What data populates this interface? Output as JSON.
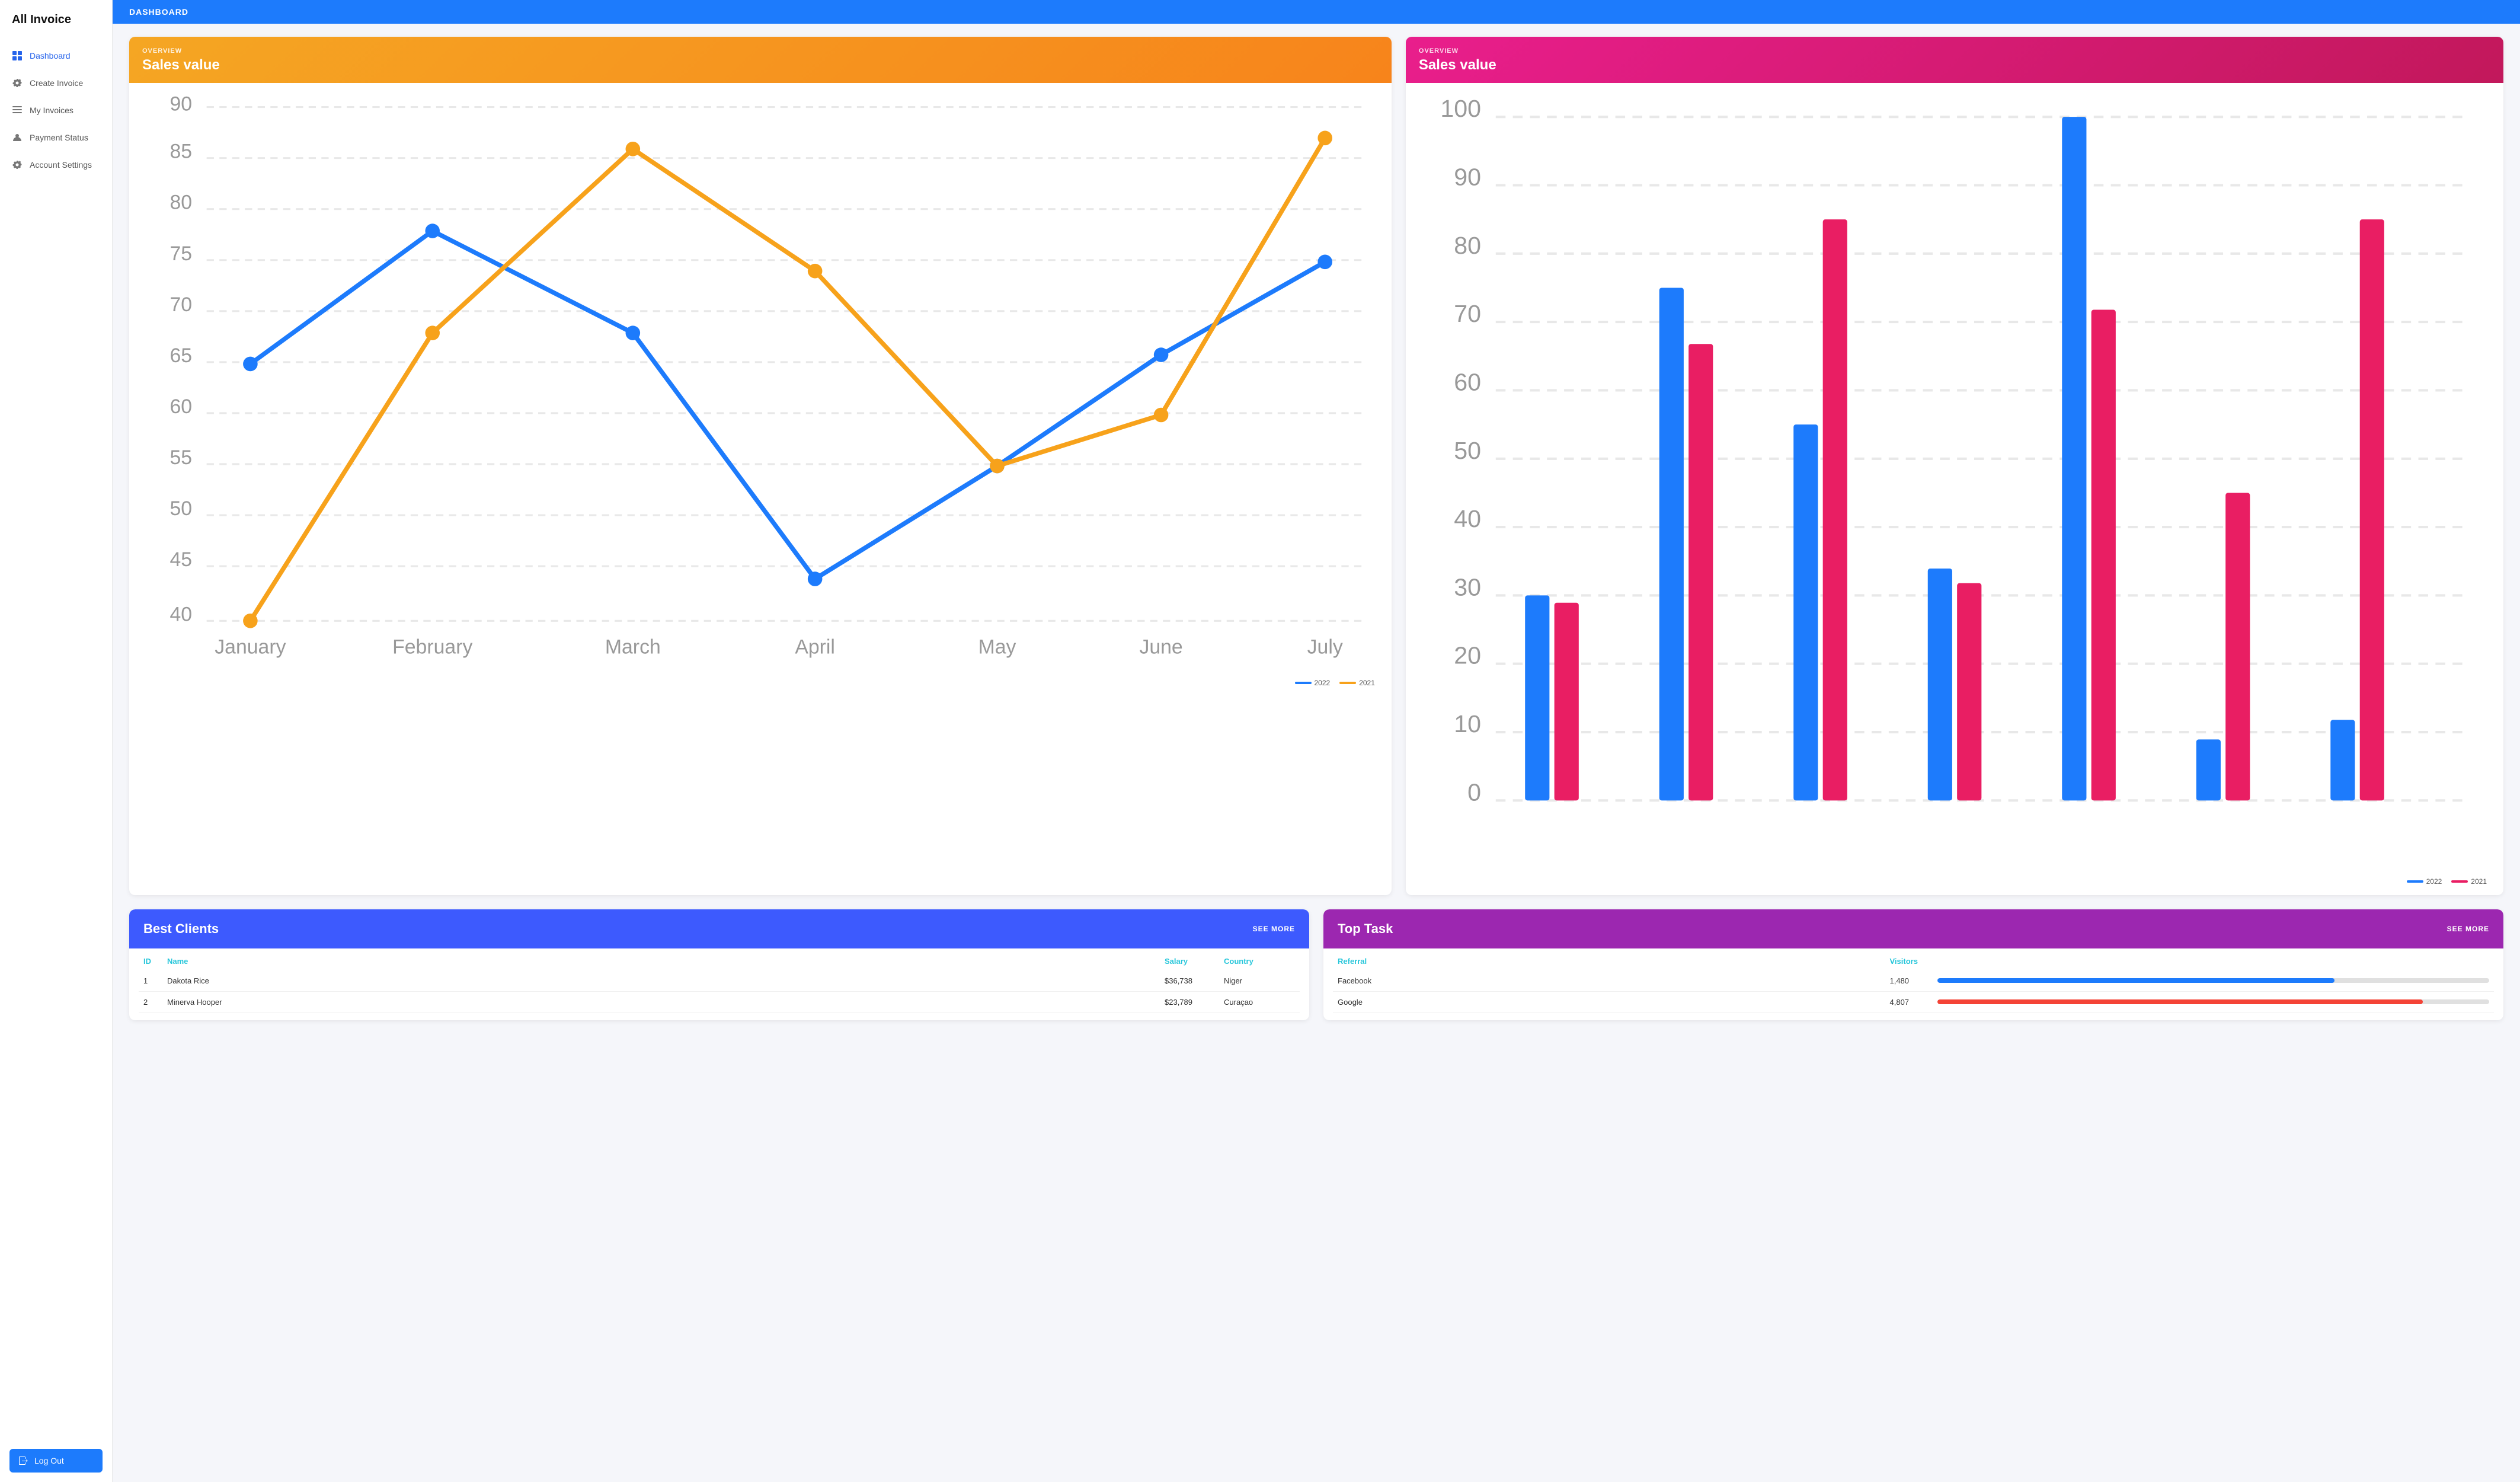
{
  "sidebar": {
    "logo": "All Invoice",
    "items": [
      {
        "id": "dashboard",
        "label": "Dashboard",
        "icon": "grid"
      },
      {
        "id": "create-invoice",
        "label": "Create Invoice",
        "icon": "gear"
      },
      {
        "id": "my-invoices",
        "label": "My Invoices",
        "icon": "list"
      },
      {
        "id": "payment-status",
        "label": "Payment Status",
        "icon": "person"
      },
      {
        "id": "account-settings",
        "label": "Account Settings",
        "icon": "gear"
      }
    ],
    "logout_label": "Log Out"
  },
  "topbar": {
    "title": "DASHBOARD"
  },
  "line_chart": {
    "header_label": "OVERVIEW",
    "header_title": "Sales value",
    "legend": [
      {
        "label": "2022",
        "color": "#1d7bfc"
      },
      {
        "label": "2021",
        "color": "#f7a21b"
      }
    ]
  },
  "bar_chart": {
    "header_label": "OVERVIEW",
    "header_title": "Sales value",
    "legend": [
      {
        "label": "2022",
        "color": "#1d7bfc"
      },
      {
        "label": "2021",
        "color": "#e91e63"
      }
    ]
  },
  "best_clients": {
    "title": "Best Clients",
    "see_more": "SEE MORE",
    "columns": [
      "ID",
      "Name",
      "Salary",
      "Country"
    ],
    "rows": [
      {
        "id": "1",
        "name": "Dakota Rice",
        "salary": "$36,738",
        "country": "Niger"
      },
      {
        "id": "2",
        "name": "Minerva Hooper",
        "salary": "$23,789",
        "country": "Curaçao"
      }
    ]
  },
  "top_task": {
    "title": "Top Task",
    "see_more": "SEE MORE",
    "columns": [
      "Referral",
      "Visitors",
      ""
    ],
    "rows": [
      {
        "referral": "Facebook",
        "visitors": "1,480",
        "progress": 72,
        "color": "#1d7bfc"
      },
      {
        "referral": "Google",
        "visitors": "4,807",
        "progress": 88,
        "color": "#f44336"
      }
    ]
  }
}
